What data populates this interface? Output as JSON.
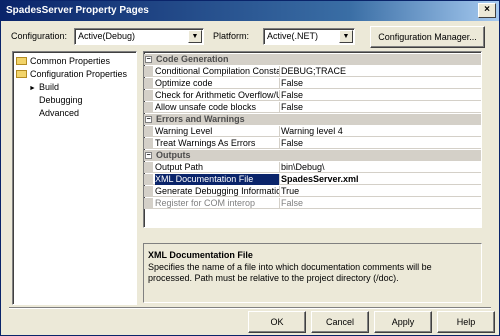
{
  "window": {
    "title": "SpadesServer Property Pages",
    "close_glyph": "×"
  },
  "toolbar": {
    "configuration_label": "Configuration:",
    "configuration_value": "Active(Debug)",
    "platform_label": "Platform:",
    "platform_value": "Active(.NET)",
    "configuration_manager_label": "Configuration Manager..."
  },
  "tree": {
    "common": "Common Properties",
    "config": "Configuration Properties",
    "children": [
      "Build",
      "Debugging",
      "Advanced"
    ]
  },
  "grid": {
    "categories": {
      "code_generation": "Code Generation",
      "errors": "Errors and Warnings",
      "outputs": "Outputs"
    },
    "rows": [
      {
        "name": "Conditional Compilation Constants",
        "value": "DEBUG;TRACE"
      },
      {
        "name": "Optimize code",
        "value": "False"
      },
      {
        "name": "Check for Arithmetic Overflow/Underflow",
        "value": "False"
      },
      {
        "name": "Allow unsafe code blocks",
        "value": "False"
      },
      {
        "name": "Warning Level",
        "value": "Warning level 4"
      },
      {
        "name": "Treat Warnings As Errors",
        "value": "False"
      },
      {
        "name": "Output Path",
        "value": "bin\\Debug\\"
      },
      {
        "name": "XML Documentation File",
        "value": "SpadesServer.xml"
      },
      {
        "name": "Generate Debugging Information",
        "value": "True"
      },
      {
        "name": "Register for COM interop",
        "value": "False"
      }
    ]
  },
  "description": {
    "title": "XML Documentation File",
    "text": "Specifies the name of a file into which documentation comments will be processed. Path must be relative to the project directory (/doc)."
  },
  "buttons": {
    "ok": "OK",
    "cancel": "Cancel",
    "apply": "Apply",
    "help": "Help"
  }
}
